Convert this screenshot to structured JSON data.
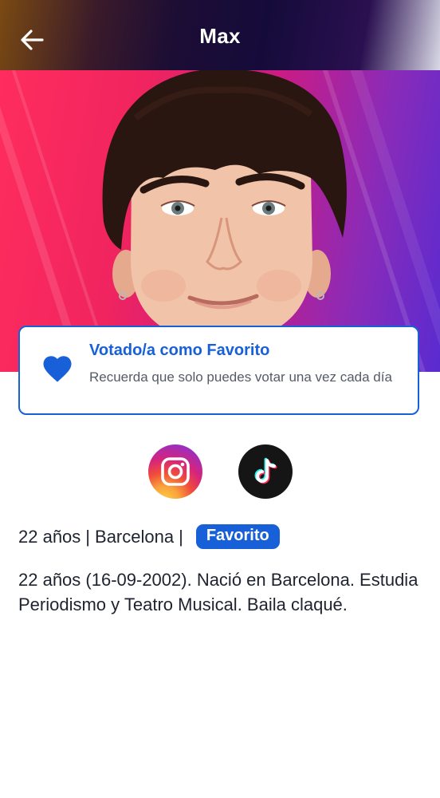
{
  "header": {
    "title": "Max",
    "back_icon": "arrow-left-icon"
  },
  "vote_card": {
    "icon": "heart-icon",
    "title": "Votado/a como Favorito",
    "subtitle": "Recuerda que solo puedes votar una vez cada día",
    "accent_color": "#1760d8"
  },
  "social": {
    "instagram_icon": "instagram-icon",
    "tiktok_icon": "tiktok-icon"
  },
  "profile": {
    "age": "22 años",
    "separator": "|",
    "city": "Barcelona",
    "badge": "Favorito",
    "bio": "22 años (16-09-2002). Nació en Barcelona. Estudia Periodismo y Teatro Musical. Baila claqué."
  }
}
